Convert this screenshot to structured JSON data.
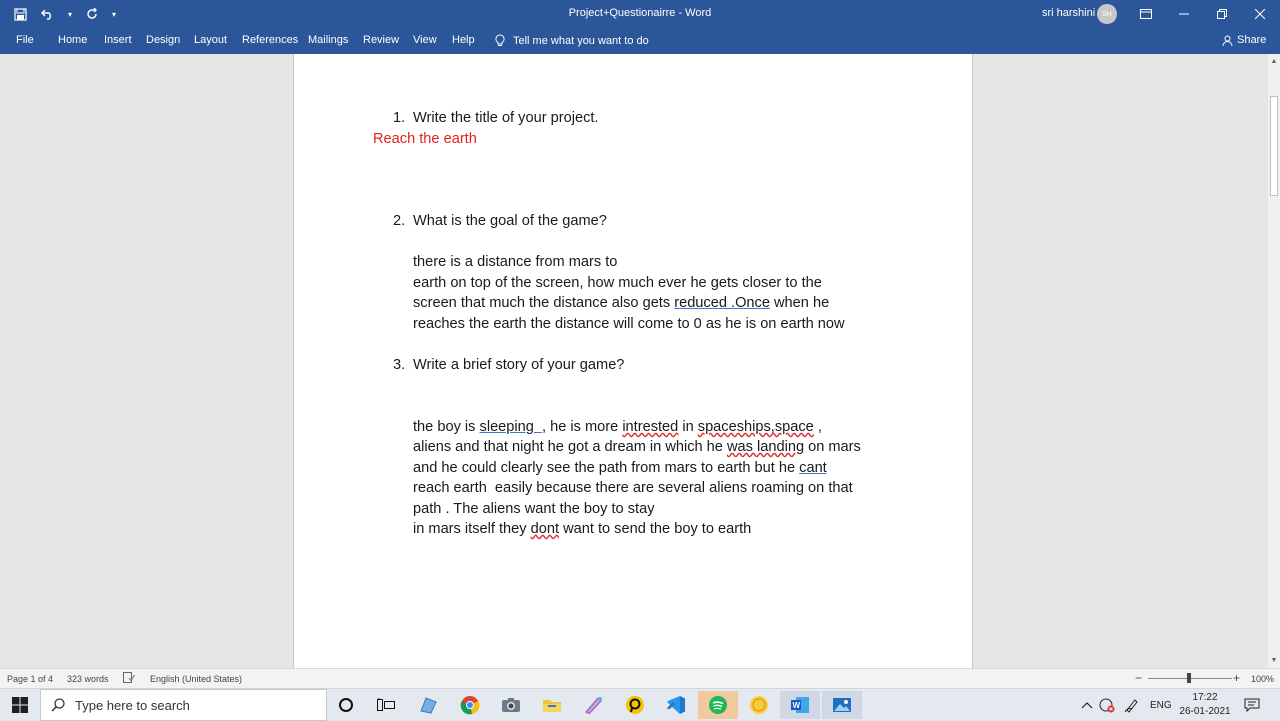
{
  "titlebar": {
    "doc_title": "Project+Questionairre  -  Word",
    "user_name": "sri harshini",
    "user_initials": "SH"
  },
  "ribbon": {
    "tabs": [
      "File",
      "Home",
      "Insert",
      "Design",
      "Layout",
      "References",
      "Mailings",
      "Review",
      "View",
      "Help"
    ],
    "tell_me": "Tell me what you want to do",
    "share": "Share"
  },
  "document": {
    "q1_num": "1.",
    "q1_text": "Write the title of your project.",
    "a1": "Reach the earth",
    "q2_num": "2.",
    "q2_text": "What is the goal of the game?",
    "a2_line1": "there is a distance from mars to",
    "a2_line2": "earth on top of the screen, how much ever he gets closer to the",
    "a2_line3a": "screen that much the distance also gets ",
    "a2_line3b": "reduced .Once",
    "a2_line3c": " when he",
    "a2_line4": "reaches the earth the distance will come to 0 as he is on earth now",
    "q3_num": "3.",
    "q3_text": "Write a brief story of your game?",
    "a3_line1a": "the boy is ",
    "a3_line1b": "sleeping  ,",
    "a3_line1c": " he is more ",
    "a3_line1d": "intrested",
    "a3_line1e": " in ",
    "a3_line1f": "spaceships,space",
    "a3_line1g": " ,",
    "a3_line2a": "aliens and that night he got a dream in which he ",
    "a3_line2b": "was landing",
    "a3_line2c": " on mars",
    "a3_line3a": "and he could clearly see the path from mars to earth but he ",
    "a3_line3b": "cant",
    "a3_line4": "reach earth  easily because there are several aliens roaming on that",
    "a3_line5": "path . The aliens want the boy to stay",
    "a3_line6a": "in mars itself they ",
    "a3_line6b": "dont",
    "a3_line6c": " want to send the boy to earth"
  },
  "statusbar": {
    "page": "Page 1 of 4",
    "words": "323 words",
    "language": "English (United States)",
    "zoom": "100%"
  },
  "taskbar": {
    "search_placeholder": "Type here to search",
    "lang": "ENG",
    "time": "17:22",
    "date": "26-01-2021"
  }
}
